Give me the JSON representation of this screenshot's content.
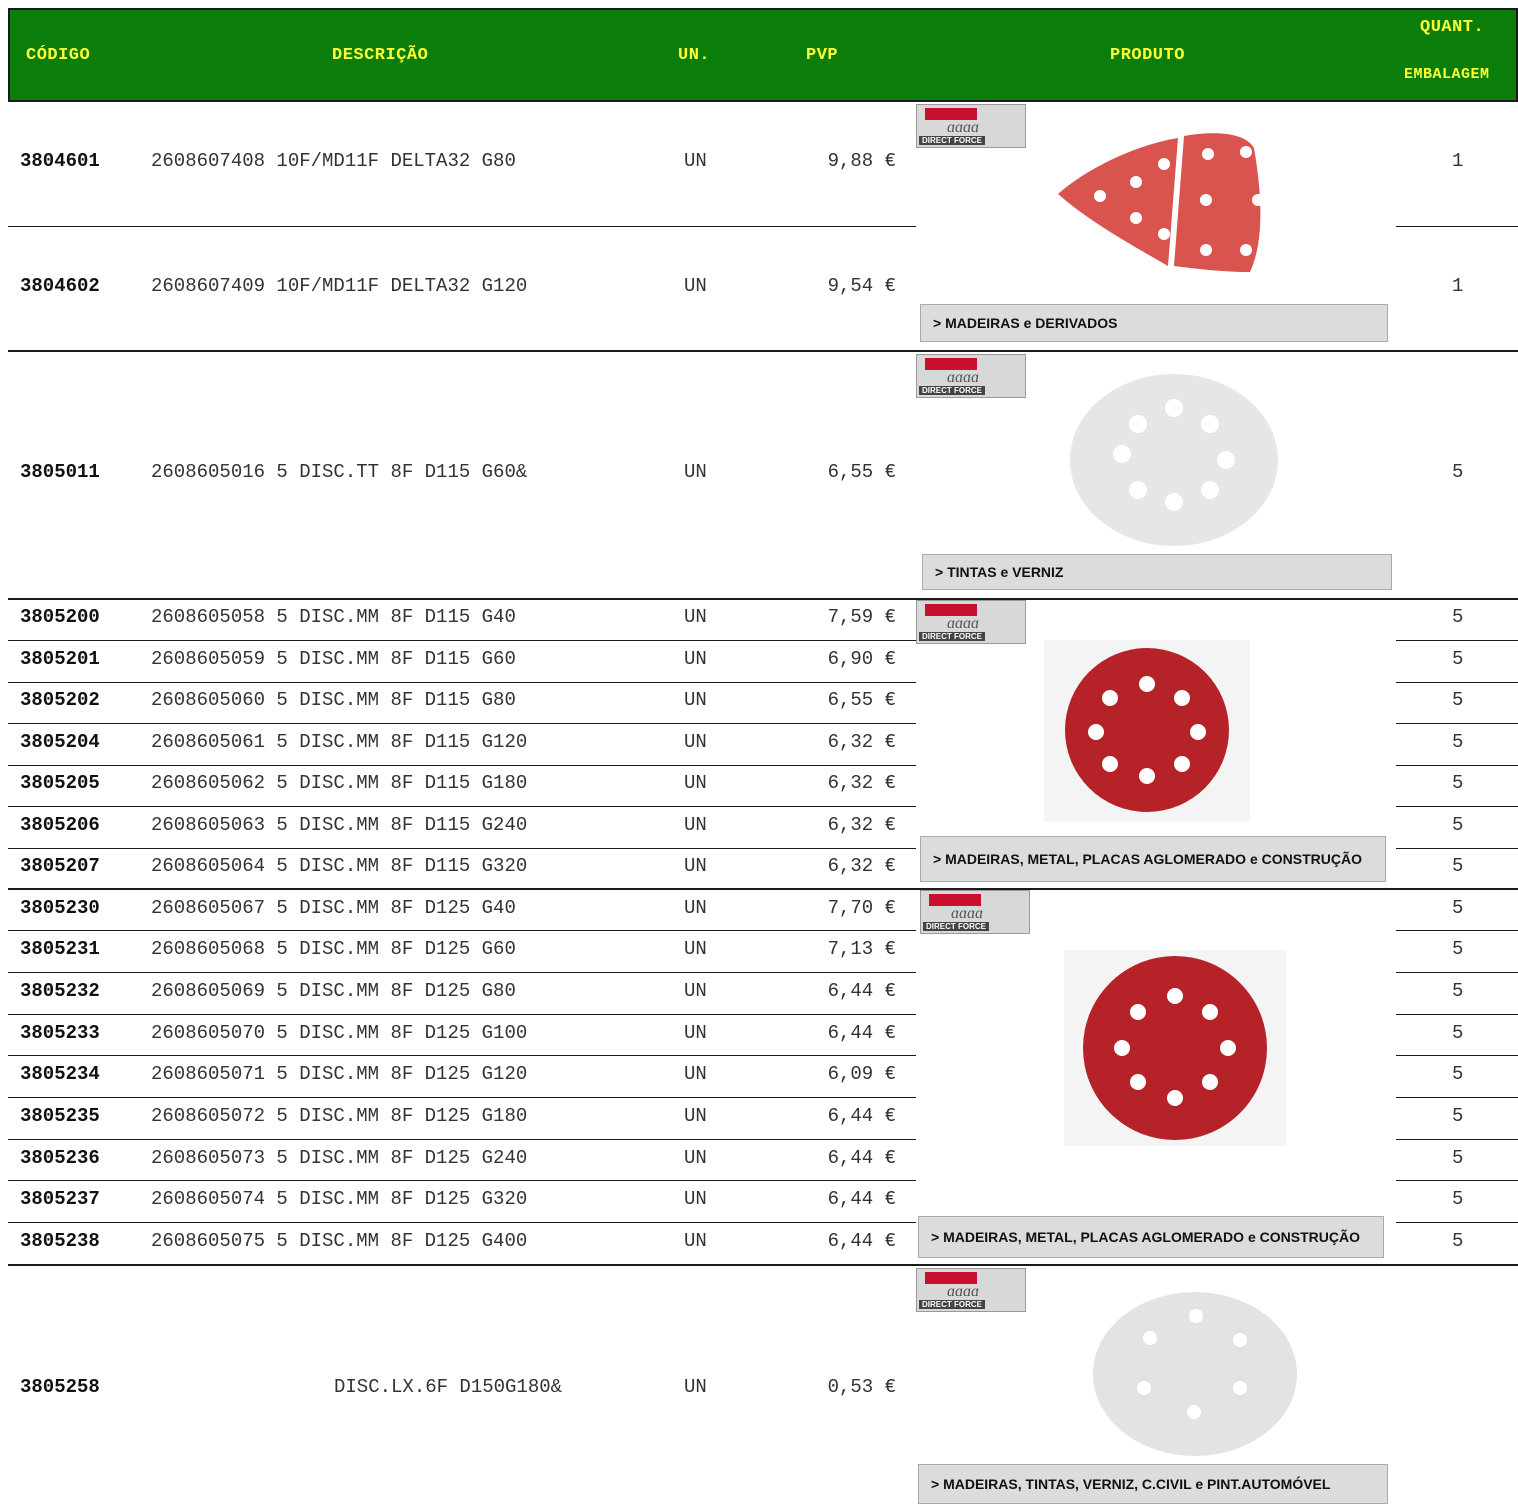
{
  "header": {
    "codigo": "CÓDIGO",
    "descricao": "DESCRIÇÃO",
    "un": "UN.",
    "pvp": "PVP",
    "produto": "PRODUTO",
    "quant": "QUANT.",
    "embalagem": "EMBALAGEM",
    "bg_color": "#0b7d0b",
    "text_color": "#ffff33"
  },
  "logo_text": "DIRECT FORCE",
  "rows": [
    {
      "code": "3804601",
      "desc": "2608607408 10F/MD11F DELTA32 G80",
      "un": "UN",
      "pvp": "9,88 €",
      "qty": "1"
    },
    {
      "code": "3804602",
      "desc": "2608607409 10F/MD11F DELTA32 G120",
      "un": "UN",
      "pvp": "9,54 €",
      "qty": "1"
    },
    {
      "code": "3805011",
      "desc": "2608605016 5 DISC.TT 8F D115 G60&",
      "un": "UN",
      "pvp": "6,55 €",
      "qty": "5"
    },
    {
      "code": "3805200",
      "desc": "2608605058 5 DISC.MM 8F D115 G40",
      "un": "UN",
      "pvp": "7,59 €",
      "qty": "5"
    },
    {
      "code": "3805201",
      "desc": "2608605059 5 DISC.MM 8F D115 G60",
      "un": "UN",
      "pvp": "6,90 €",
      "qty": "5"
    },
    {
      "code": "3805202",
      "desc": "2608605060 5 DISC.MM 8F D115 G80",
      "un": "UN",
      "pvp": "6,55 €",
      "qty": "5"
    },
    {
      "code": "3805204",
      "desc": "2608605061 5 DISC.MM 8F D115 G120",
      "un": "UN",
      "pvp": "6,32 €",
      "qty": "5"
    },
    {
      "code": "3805205",
      "desc": "2608605062 5 DISC.MM 8F D115 G180",
      "un": "UN",
      "pvp": "6,32 €",
      "qty": "5"
    },
    {
      "code": "3805206",
      "desc": "2608605063 5 DISC.MM 8F D115 G240",
      "un": "UN",
      "pvp": "6,32 €",
      "qty": "5"
    },
    {
      "code": "3805207",
      "desc": "2608605064 5 DISC.MM 8F D115 G320",
      "un": "UN",
      "pvp": "6,32 €",
      "qty": "5"
    },
    {
      "code": "3805230",
      "desc": "2608605067 5 DISC.MM 8F D125 G40",
      "un": "UN",
      "pvp": "7,70 €",
      "qty": "5"
    },
    {
      "code": "3805231",
      "desc": "2608605068 5 DISC.MM 8F D125 G60",
      "un": "UN",
      "pvp": "7,13 €",
      "qty": "5"
    },
    {
      "code": "3805232",
      "desc": "2608605069 5 DISC.MM 8F D125 G80",
      "un": "UN",
      "pvp": "6,44 €",
      "qty": "5"
    },
    {
      "code": "3805233",
      "desc": "2608605070 5 DISC.MM 8F D125 G100",
      "un": "UN",
      "pvp": "6,44 €",
      "qty": "5"
    },
    {
      "code": "3805234",
      "desc": "2608605071 5 DISC.MM 8F D125 G120",
      "un": "UN",
      "pvp": "6,09 €",
      "qty": "5"
    },
    {
      "code": "3805235",
      "desc": "2608605072 5 DISC.MM 8F D125 G180",
      "un": "UN",
      "pvp": "6,44 €",
      "qty": "5"
    },
    {
      "code": "3805236",
      "desc": "2608605073 5 DISC.MM 8F D125 G240",
      "un": "UN",
      "pvp": "6,44 €",
      "qty": "5"
    },
    {
      "code": "3805237",
      "desc": "2608605074 5 DISC.MM 8F D125 G320",
      "un": "UN",
      "pvp": "6,44 €",
      "qty": "5"
    },
    {
      "code": "3805238",
      "desc": "2608605075 5 DISC.MM 8F D125 G400",
      "un": "UN",
      "pvp": "6,44 €",
      "qty": "5"
    },
    {
      "code": "3805258",
      "desc": "DISC.LX.6F D150G180&",
      "un": "UN",
      "pvp": "0,53 €",
      "qty": ""
    }
  ],
  "categories": [
    "> MADEIRAS e DERIVADOS",
    "> TINTAS e VERNIZ",
    "> MADEIRAS, METAL, PLACAS AGLOMERADO e CONSTRUÇÃO",
    "> MADEIRAS, METAL, PLACAS AGLOMERADO e CONSTRUÇÃO",
    "> MADEIRAS, TINTAS, VERNIZ, C.CIVIL e PINT.AUTOMÓVEL"
  ]
}
